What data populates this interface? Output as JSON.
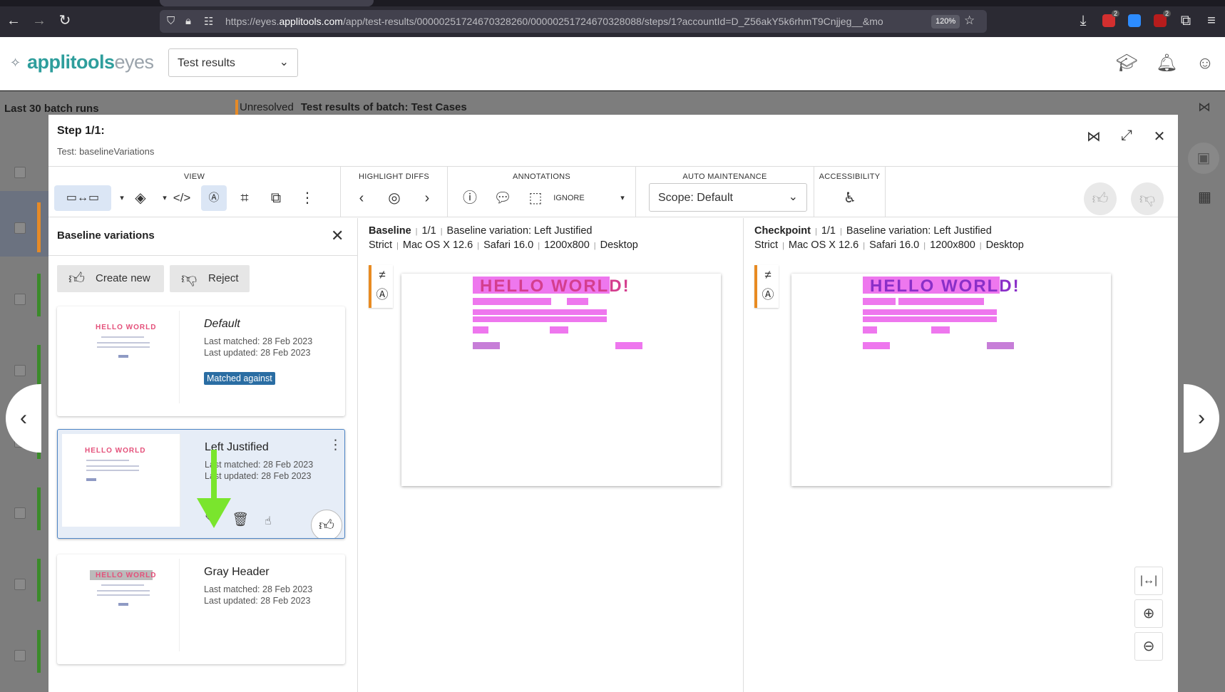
{
  "browser": {
    "url_prefix": "https://eyes.",
    "url_domain": "applitools.com",
    "url_rest": "/app/test-results/00000251724670328260/00000251724670328088/steps/1?accountId=D_Z56akY5k6rhmT9Cnjjeg__&mo",
    "zoom": "120%",
    "ext_badge_1": "2",
    "ext_badge_2": "2"
  },
  "app": {
    "logo_bold": "applitools",
    "logo_light": "eyes",
    "page_select": "Test results"
  },
  "background": {
    "left_title": "Last 30 batch runs",
    "status": "Unresolved",
    "batch_title": "Test results of batch: Test Cases"
  },
  "modal": {
    "title": "Step 1/1:",
    "subtitle": "Test: baselineVariations"
  },
  "toolbar": {
    "view_label": "VIEW",
    "highlight_label": "HIGHLIGHT DIFFS",
    "annotations_label": "ANNOTATIONS",
    "ignore_label": "IGNORE",
    "auto_label": "AUTO MAINTENANCE",
    "scope": "Scope: Default",
    "accessibility_label": "ACCESSIBILITY"
  },
  "variations_panel": {
    "title": "Baseline variations",
    "create_new": "Create new",
    "reject": "Reject",
    "cards": [
      {
        "name": "Default",
        "matched": "Last matched: 28 Feb 2023",
        "updated": "Last updated: 28 Feb 2023",
        "badge": "Matched against"
      },
      {
        "name": "Left Justified",
        "matched": "Last matched: 28 Feb 2023",
        "updated": "Last updated: 28 Feb 2023"
      },
      {
        "name": "Gray Header",
        "matched": "Last matched: 28 Feb 2023",
        "updated": "Last updated: 28 Feb 2023"
      }
    ],
    "thumb_text": "HELLO WORLD"
  },
  "baseline": {
    "label": "Baseline",
    "count": "1/1",
    "variation": "Baseline variation: Left Justified",
    "match": "Strict",
    "os": "Mac OS X 12.6",
    "browser": "Safari 16.0",
    "size": "1200x800",
    "device": "Desktop",
    "heading": "HELLO WORLD!"
  },
  "checkpoint": {
    "label": "Checkpoint",
    "count": "1/1",
    "variation": "Baseline variation: Left Justified",
    "match": "Strict",
    "os": "Mac OS X 12.6",
    "browser": "Safari 16.0",
    "size": "1200x800",
    "device": "Desktop",
    "heading": "HELLO WORLD!"
  },
  "colors": {
    "brand_teal": "#2e9e9c",
    "highlight": "#ee77ee",
    "pane_accent": "#e88b22",
    "badge_blue": "#2a6da3",
    "annotation_arrow": "#7ae52d"
  }
}
